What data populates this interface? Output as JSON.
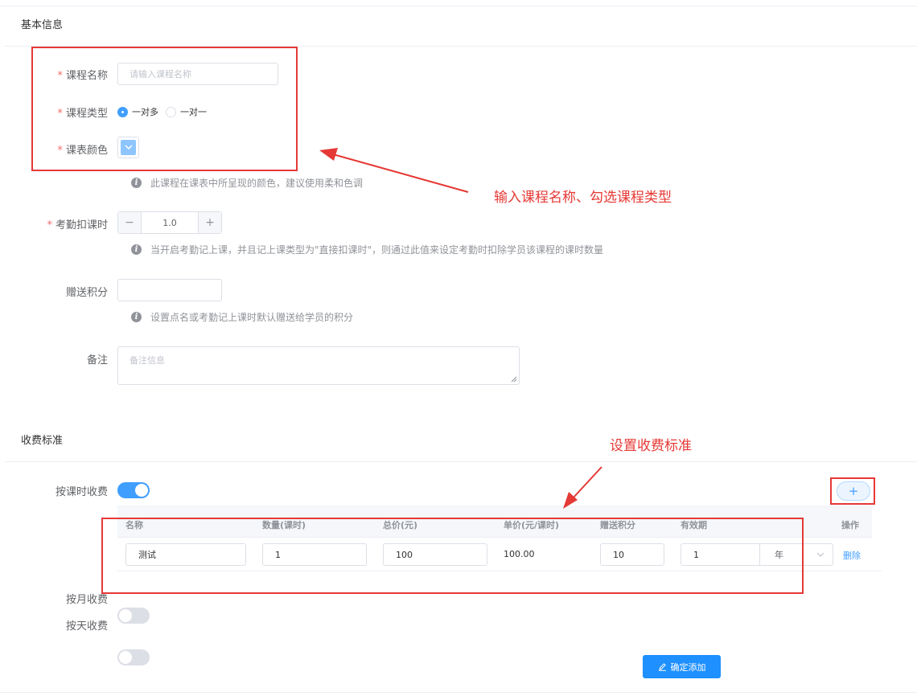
{
  "basic": {
    "section_title": "基本信息",
    "course_name": {
      "label": "课程名称",
      "required_mark": "*",
      "placeholder": "请输入课程名称"
    },
    "course_type": {
      "label": "课程类型",
      "required_mark": "*",
      "options": [
        "一对多",
        "一对一"
      ],
      "selected": "一对多"
    },
    "course_color": {
      "label": "课表颜色",
      "required_mark": "*",
      "swatch_color": "#8ec5ff",
      "hint": "此课程在课表中所呈现的颜色，建议使用柔和色调"
    },
    "attendance_hours": {
      "label": "考勤扣课时",
      "required_mark": "*",
      "value": "1.0",
      "minus": "−",
      "plus": "+",
      "hint": "当开启考勤记上课，并且记上课类型为\"直接扣课时\"，则通过此值来设定考勤时扣除学员该课程的课时数量"
    },
    "bonus_points": {
      "label": "赠送积分",
      "value": "",
      "hint": "设置点名或考勤记上课时默认赠送给学员的积分"
    },
    "remark": {
      "label": "备注",
      "placeholder": "备注信息"
    }
  },
  "fee": {
    "section_title": "收费标准",
    "by_hour": {
      "label": "按课时收费",
      "on": true
    },
    "by_month": {
      "label": "按月收费",
      "on": false
    },
    "by_day": {
      "label": "按天收费",
      "on": false
    },
    "add_icon": "+",
    "columns": [
      "名称",
      "数量(课时)",
      "总价(元)",
      "单价(元/课时)",
      "赠送积分",
      "有效期",
      "操作"
    ],
    "row": {
      "name": "测试",
      "quantity": "1",
      "total": "100",
      "unit_price": "100.00",
      "points": "10",
      "validity": "1",
      "validity_unit": "年",
      "action": "删除"
    }
  },
  "submit_label": "确定添加",
  "annotations": {
    "top": "输入课程名称、勾选课程类型",
    "fee": "设置收费标准"
  },
  "colors": {
    "accent": "#409eff",
    "annotation": "#e53935"
  }
}
